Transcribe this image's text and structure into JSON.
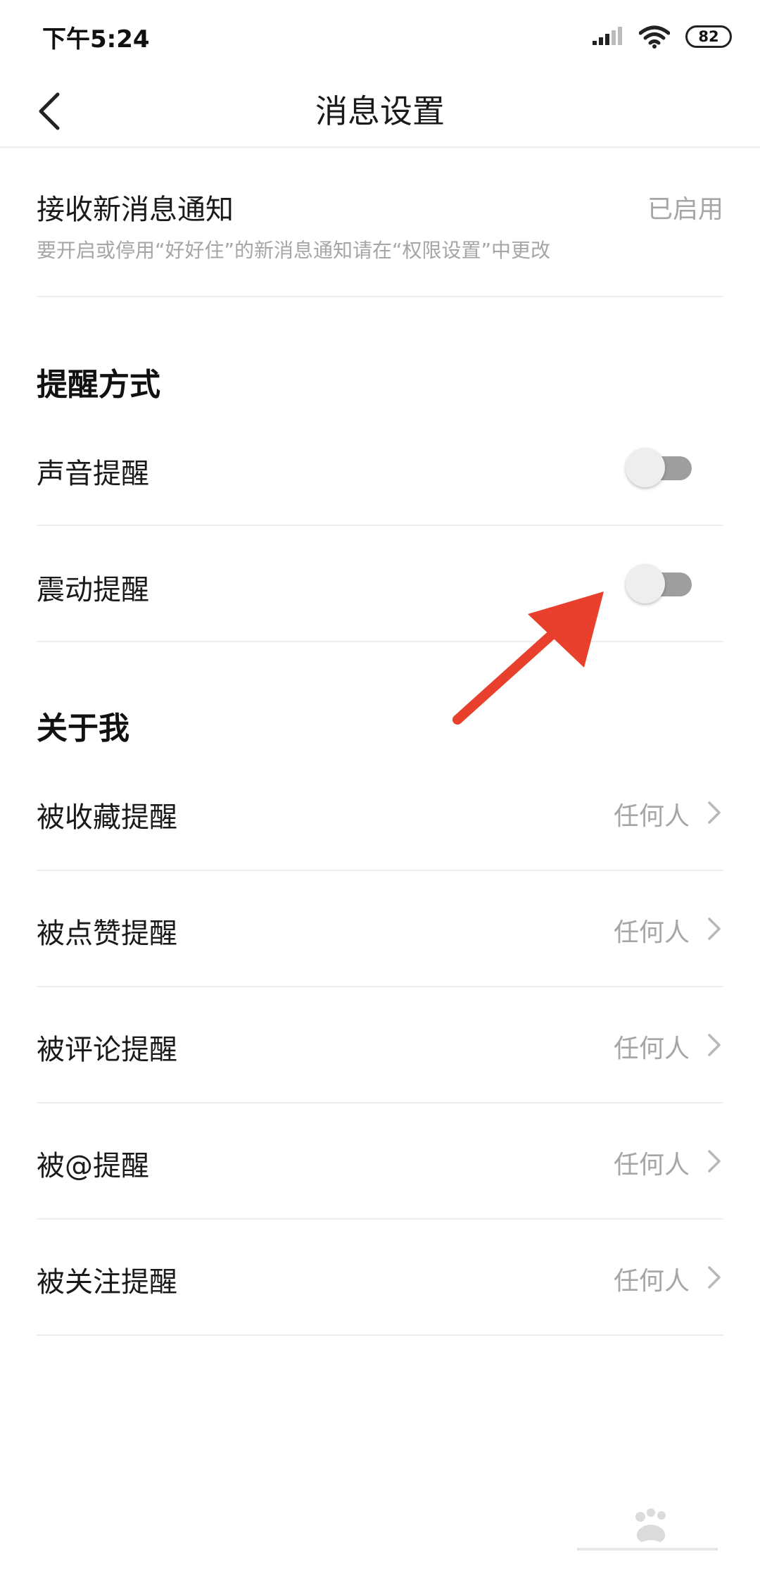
{
  "status_bar": {
    "time": "下午5:24",
    "battery": "82"
  },
  "nav": {
    "title": "消息设置"
  },
  "notification": {
    "title": "接收新消息通知",
    "status": "已启用",
    "description": "要开启或停用“好好住”的新消息通知请在“权限设置”中更改"
  },
  "reminder_section": {
    "header": "提醒方式",
    "items": [
      {
        "label": "声音提醒",
        "enabled": false
      },
      {
        "label": "震动提醒",
        "enabled": false
      }
    ]
  },
  "about_me_section": {
    "header": "关于我",
    "items": [
      {
        "label": "被收藏提醒",
        "value": "任何人"
      },
      {
        "label": "被点赞提醒",
        "value": "任何人"
      },
      {
        "label": "被评论提醒",
        "value": "任何人"
      },
      {
        "label": "被@提醒",
        "value": "任何人"
      },
      {
        "label": "被关注提醒",
        "value": "任何人"
      }
    ]
  },
  "colors": {
    "annotation_arrow": "#e8402c",
    "secondary_text": "#a6a6a6"
  }
}
